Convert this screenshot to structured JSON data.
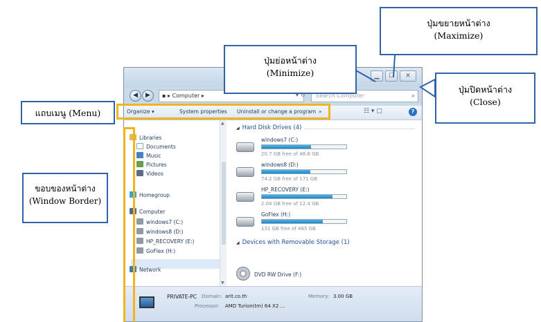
{
  "window": {
    "address": "Computer",
    "search_placeholder": "Search Computer",
    "menu": {
      "organize": "Organize ▾",
      "system_properties": "System properties",
      "uninstall": "Uninstall or change a program",
      "more": "»"
    },
    "nav": {
      "libraries": "Libraries",
      "documents": "Documents",
      "music": "Music",
      "pictures": "Pictures",
      "videos": "Videos",
      "homegroup": "Homegroup",
      "computer": "Computer",
      "drive_c": "windows7 (C:)",
      "drive_d": "windows8 (D:)",
      "drive_e": "HP_RECOVERY (E:)",
      "drive_h": "GoFlex (H:)",
      "network": "Network"
    },
    "content": {
      "hdd_header": "Hard Disk Drives (4)",
      "removable_header": "Devices with Removable Storage (1)",
      "drives": [
        {
          "name": "windows7 (C:)",
          "free": "20.7 GB free of 48.8 GB",
          "used_fraction": 0.58
        },
        {
          "name": "windows8 (D:)",
          "free": "74.2 GB free of 171 GB",
          "used_fraction": 0.57
        },
        {
          "name": "HP_RECOVERY (E:)",
          "free": "2.04 GB free of 12.4 GB",
          "used_fraction": 0.84
        },
        {
          "name": "GoFlex (H:)",
          "free": "131 GB free of 465 GB",
          "used_fraction": 0.72
        }
      ],
      "dvd": "DVD RW Drive (F:)"
    },
    "details": {
      "pc_name": "PRIVATE-PC",
      "domain_label": "Domain:",
      "domain_value": "arit.co.th",
      "memory_label": "Memory:",
      "memory_value": "3.00 GB",
      "processor_label": "Processor:",
      "processor_value": "AMD Turion(tm) 64 X2 ..."
    }
  },
  "callouts": {
    "maximize": {
      "line1": "ปุ่มขยายหน้าต่าง",
      "line2": "(Maximize)"
    },
    "minimize": {
      "line1": "ปุ่มย่อหน้าต่าง",
      "line2": "(Minimize)"
    },
    "close": {
      "line1": "ปุ่มปิดหน้าต่าง",
      "line2": "(Close)"
    },
    "menu": {
      "line1": "แถบเมนู (Menu)"
    },
    "border": {
      "line1": "ขอบของหน้าต่าง",
      "line2": "(Window Border)"
    }
  },
  "colors": {
    "highlight": "#f0b41c",
    "callout_border": "#2f63a6",
    "progress": "#1e86c6"
  }
}
